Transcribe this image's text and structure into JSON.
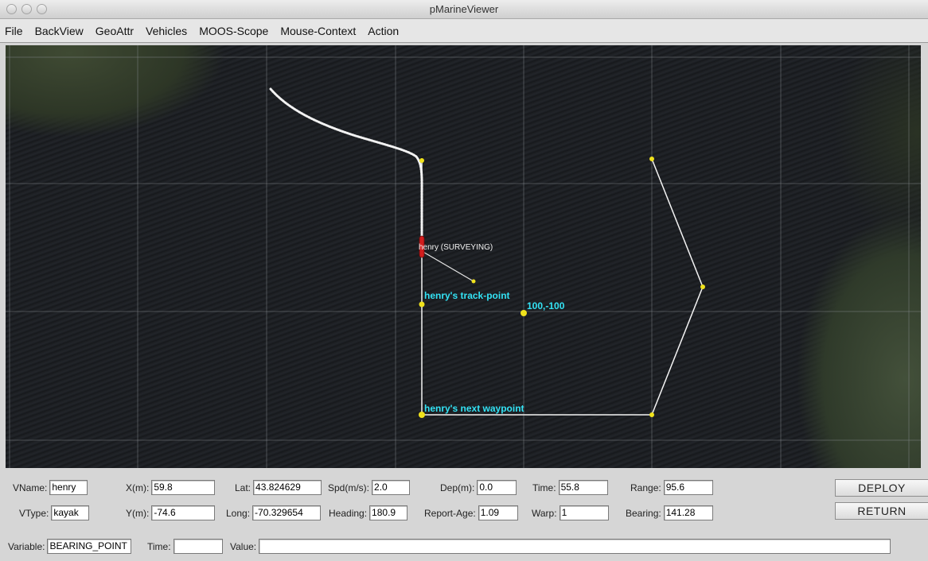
{
  "window": {
    "title": "pMarineViewer"
  },
  "menu": [
    "File",
    "BackView",
    "GeoAttr",
    "Vehicles",
    "MOOS-Scope",
    "Mouse-Context",
    "Action"
  ],
  "map": {
    "vehicle_label": "henry (SURVEYING)",
    "track_point_label": "henry's track-point",
    "point_label": "100,-100",
    "next_waypoint_label": "henry's next waypoint",
    "colors": {
      "label": "#33e3f5",
      "path": "#ffffff",
      "marker": "#f0e21c",
      "vehicle": "#d11d1d"
    }
  },
  "fields": {
    "vname": {
      "label": "VName:",
      "value": "henry"
    },
    "vtype": {
      "label": "VType:",
      "value": "kayak"
    },
    "x": {
      "label": "X(m):",
      "value": "59.8"
    },
    "y": {
      "label": "Y(m):",
      "value": "-74.6"
    },
    "lat": {
      "label": "Lat:",
      "value": "43.824629"
    },
    "long": {
      "label": "Long:",
      "value": "-70.329654"
    },
    "spd": {
      "label": "Spd(m/s):",
      "value": "2.0"
    },
    "heading": {
      "label": "Heading:",
      "value": "180.9"
    },
    "dep": {
      "label": "Dep(m):",
      "value": "0.0"
    },
    "report_age": {
      "label": "Report-Age:",
      "value": "1.09"
    },
    "time": {
      "label": "Time:",
      "value": "55.8"
    },
    "warp": {
      "label": "Warp:",
      "value": "1"
    },
    "range": {
      "label": "Range:",
      "value": "95.6"
    },
    "bearing": {
      "label": "Bearing:",
      "value": "141.28"
    }
  },
  "buttons": {
    "deploy": "DEPLOY",
    "return": "RETURN"
  },
  "scope": {
    "variable_label": "Variable:",
    "variable_value": "BEARING_POINT",
    "time_label": "Time:",
    "time_value": "",
    "value_label": "Value:",
    "value_value": ""
  }
}
